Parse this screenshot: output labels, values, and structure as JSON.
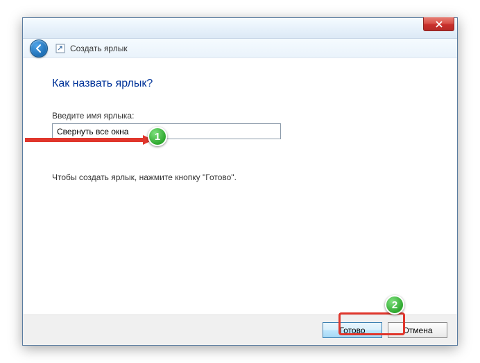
{
  "window": {
    "wizard_title": "Создать ярлык"
  },
  "content": {
    "heading": "Как назвать ярлык?",
    "field_label": "Введите имя ярлыка:",
    "field_value": "Свернуть все окна",
    "hint": "Чтобы создать ярлык, нажмите кнопку \"Готово\"."
  },
  "footer": {
    "primary_label": "Готово",
    "cancel_label": "Отмена"
  },
  "annotations": {
    "marker1": "1",
    "marker2": "2"
  }
}
